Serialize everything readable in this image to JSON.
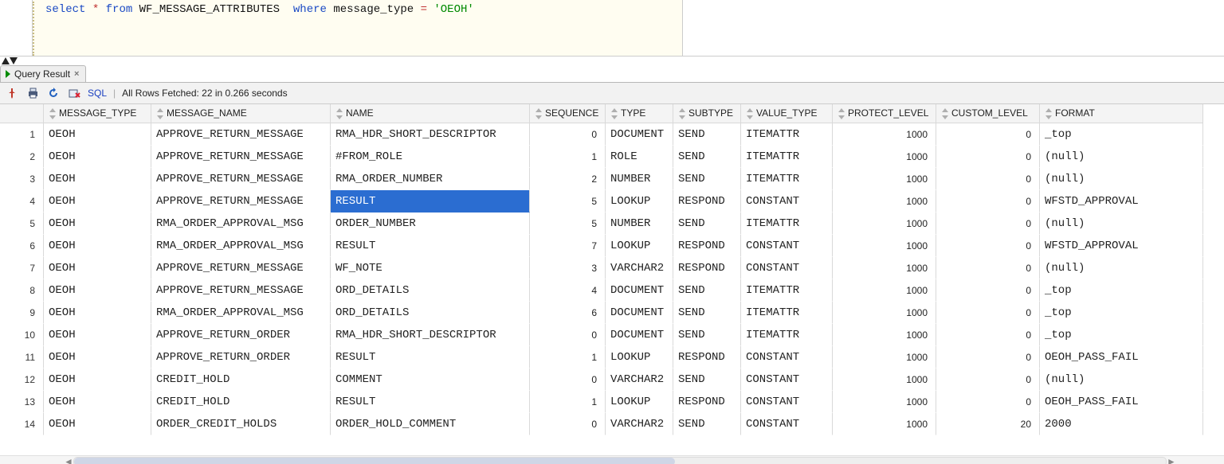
{
  "sql": {
    "tokens": [
      {
        "t": "select",
        "c": "kw"
      },
      {
        "t": " ",
        "c": ""
      },
      {
        "t": "*",
        "c": "op"
      },
      {
        "t": " ",
        "c": ""
      },
      {
        "t": "from",
        "c": "kw"
      },
      {
        "t": " ",
        "c": ""
      },
      {
        "t": "WF_MESSAGE_ATTRIBUTES",
        "c": "ident"
      },
      {
        "t": "  ",
        "c": ""
      },
      {
        "t": "where",
        "c": "kw"
      },
      {
        "t": " ",
        "c": ""
      },
      {
        "t": "message_type",
        "c": "ident"
      },
      {
        "t": " ",
        "c": ""
      },
      {
        "t": "=",
        "c": "op"
      },
      {
        "t": " ",
        "c": ""
      },
      {
        "t": "'OEOH'",
        "c": "tkgreen"
      }
    ]
  },
  "tabs": {
    "query_result_label": "Query Result"
  },
  "toolbar": {
    "sql_link": "SQL",
    "status": "All Rows Fetched: 22 in 0.266 seconds"
  },
  "grid": {
    "columns": [
      {
        "key": "message_type",
        "label": "MESSAGE_TYPE",
        "align": "left",
        "mono": true
      },
      {
        "key": "message_name",
        "label": "MESSAGE_NAME",
        "align": "left",
        "mono": true
      },
      {
        "key": "name",
        "label": "NAME",
        "align": "left",
        "mono": true
      },
      {
        "key": "sequence",
        "label": "SEQUENCE",
        "align": "right",
        "mono": false
      },
      {
        "key": "type",
        "label": "TYPE",
        "align": "left",
        "mono": true
      },
      {
        "key": "subtype",
        "label": "SUBTYPE",
        "align": "left",
        "mono": true
      },
      {
        "key": "value_type",
        "label": "VALUE_TYPE",
        "align": "left",
        "mono": true
      },
      {
        "key": "protect_level",
        "label": "PROTECT_LEVEL",
        "align": "right",
        "mono": false
      },
      {
        "key": "custom_level",
        "label": "CUSTOM_LEVEL",
        "align": "right",
        "mono": false
      },
      {
        "key": "format",
        "label": "FORMAT",
        "align": "left",
        "mono": true
      }
    ],
    "selected": {
      "row": 3,
      "col": "name"
    },
    "rows": [
      {
        "message_type": "OEOH",
        "message_name": "APPROVE_RETURN_MESSAGE",
        "name": "RMA_HDR_SHORT_DESCRIPTOR",
        "sequence": 0,
        "type": "DOCUMENT",
        "subtype": "SEND",
        "value_type": "ITEMATTR",
        "protect_level": 1000,
        "custom_level": 0,
        "format": "_top"
      },
      {
        "message_type": "OEOH",
        "message_name": "APPROVE_RETURN_MESSAGE",
        "name": "#FROM_ROLE",
        "sequence": 1,
        "type": "ROLE",
        "subtype": "SEND",
        "value_type": "ITEMATTR",
        "protect_level": 1000,
        "custom_level": 0,
        "format": "(null)"
      },
      {
        "message_type": "OEOH",
        "message_name": "APPROVE_RETURN_MESSAGE",
        "name": "RMA_ORDER_NUMBER",
        "sequence": 2,
        "type": "NUMBER",
        "subtype": "SEND",
        "value_type": "ITEMATTR",
        "protect_level": 1000,
        "custom_level": 0,
        "format": "(null)"
      },
      {
        "message_type": "OEOH",
        "message_name": "APPROVE_RETURN_MESSAGE",
        "name": "RESULT",
        "sequence": 5,
        "type": "LOOKUP",
        "subtype": "RESPOND",
        "value_type": "CONSTANT",
        "protect_level": 1000,
        "custom_level": 0,
        "format": "WFSTD_APPROVAL"
      },
      {
        "message_type": "OEOH",
        "message_name": "RMA_ORDER_APPROVAL_MSG",
        "name": "ORDER_NUMBER",
        "sequence": 5,
        "type": "NUMBER",
        "subtype": "SEND",
        "value_type": "ITEMATTR",
        "protect_level": 1000,
        "custom_level": 0,
        "format": "(null)"
      },
      {
        "message_type": "OEOH",
        "message_name": "RMA_ORDER_APPROVAL_MSG",
        "name": "RESULT",
        "sequence": 7,
        "type": "LOOKUP",
        "subtype": "RESPOND",
        "value_type": "CONSTANT",
        "protect_level": 1000,
        "custom_level": 0,
        "format": "WFSTD_APPROVAL"
      },
      {
        "message_type": "OEOH",
        "message_name": "APPROVE_RETURN_MESSAGE",
        "name": "WF_NOTE",
        "sequence": 3,
        "type": "VARCHAR2",
        "subtype": "RESPOND",
        "value_type": "CONSTANT",
        "protect_level": 1000,
        "custom_level": 0,
        "format": "(null)"
      },
      {
        "message_type": "OEOH",
        "message_name": "APPROVE_RETURN_MESSAGE",
        "name": "ORD_DETAILS",
        "sequence": 4,
        "type": "DOCUMENT",
        "subtype": "SEND",
        "value_type": "ITEMATTR",
        "protect_level": 1000,
        "custom_level": 0,
        "format": "_top"
      },
      {
        "message_type": "OEOH",
        "message_name": "RMA_ORDER_APPROVAL_MSG",
        "name": "ORD_DETAILS",
        "sequence": 6,
        "type": "DOCUMENT",
        "subtype": "SEND",
        "value_type": "ITEMATTR",
        "protect_level": 1000,
        "custom_level": 0,
        "format": "_top"
      },
      {
        "message_type": "OEOH",
        "message_name": "APPROVE_RETURN_ORDER",
        "name": "RMA_HDR_SHORT_DESCRIPTOR",
        "sequence": 0,
        "type": "DOCUMENT",
        "subtype": "SEND",
        "value_type": "ITEMATTR",
        "protect_level": 1000,
        "custom_level": 0,
        "format": "_top"
      },
      {
        "message_type": "OEOH",
        "message_name": "APPROVE_RETURN_ORDER",
        "name": "RESULT",
        "sequence": 1,
        "type": "LOOKUP",
        "subtype": "RESPOND",
        "value_type": "CONSTANT",
        "protect_level": 1000,
        "custom_level": 0,
        "format": "OEOH_PASS_FAIL"
      },
      {
        "message_type": "OEOH",
        "message_name": "CREDIT_HOLD",
        "name": "COMMENT",
        "sequence": 0,
        "type": "VARCHAR2",
        "subtype": "SEND",
        "value_type": "CONSTANT",
        "protect_level": 1000,
        "custom_level": 0,
        "format": "(null)"
      },
      {
        "message_type": "OEOH",
        "message_name": "CREDIT_HOLD",
        "name": "RESULT",
        "sequence": 1,
        "type": "LOOKUP",
        "subtype": "RESPOND",
        "value_type": "CONSTANT",
        "protect_level": 1000,
        "custom_level": 0,
        "format": "OEOH_PASS_FAIL"
      },
      {
        "message_type": "OEOH",
        "message_name": "ORDER_CREDIT_HOLDS",
        "name": "ORDER_HOLD_COMMENT",
        "sequence": 0,
        "type": "VARCHAR2",
        "subtype": "SEND",
        "value_type": "CONSTANT",
        "protect_level": 1000,
        "custom_level": 20,
        "format": "2000"
      }
    ]
  }
}
